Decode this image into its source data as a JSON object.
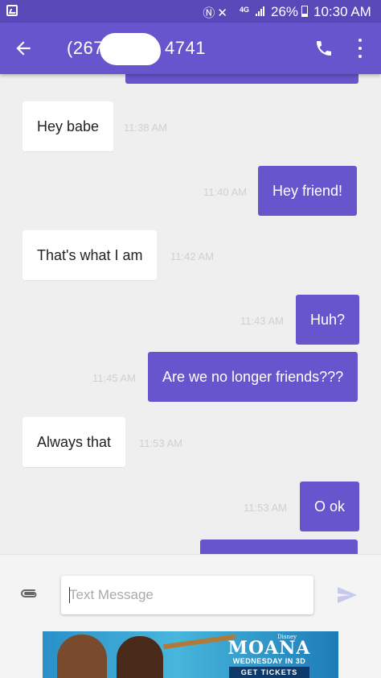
{
  "status_bar": {
    "network": "4G",
    "battery": "26%",
    "time": "10:30 AM"
  },
  "header": {
    "contact_prefix": "(267",
    "contact_suffix": "4741",
    "back_icon": "arrow-left-icon",
    "call_icon": "phone-icon",
    "menu_icon": "more-vert-icon"
  },
  "messages": [
    {
      "direction": "in",
      "text": "Hey babe",
      "time": "11:38 AM"
    },
    {
      "direction": "out",
      "text": "Hey friend!",
      "time": "11:40 AM"
    },
    {
      "direction": "in",
      "text": "That's what I am",
      "time": "11:42 AM"
    },
    {
      "direction": "out",
      "text": "Huh?",
      "time": "11:43 AM"
    },
    {
      "direction": "out",
      "text": "Are we no longer friends???",
      "time": "11:45 AM"
    },
    {
      "direction": "in",
      "text": "Always that",
      "time": "11:53 AM"
    },
    {
      "direction": "out",
      "text": "O ok",
      "time": "11:53 AM"
    }
  ],
  "compose": {
    "placeholder": "Text Message",
    "attach_icon": "paperclip-icon",
    "send_icon": "send-icon"
  },
  "ad": {
    "studio": "Disney",
    "title": "MOANA",
    "subtitle": "WEDNESDAY IN 3D",
    "cta": "GET TICKETS"
  },
  "colors": {
    "accent": "#6655cc",
    "status_bar": "#5848b8",
    "background": "#efefef"
  }
}
